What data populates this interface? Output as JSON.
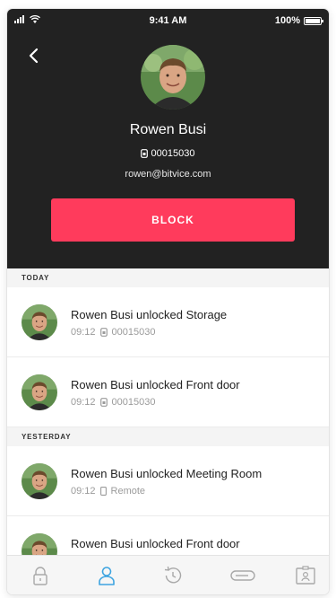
{
  "status_bar": {
    "time": "9:41 AM",
    "battery": "100%",
    "battery_level": 1.0
  },
  "profile": {
    "name": "Rowen Busi",
    "card_number": "00015030",
    "email": "rowen@bitvice.com",
    "block_label": "BLOCK"
  },
  "colors": {
    "header_bg": "#222222",
    "accent": "#ff3b5c",
    "tab_active": "#3ea4e0"
  },
  "sections": {
    "today": "TODAY",
    "yesterday": "YESTERDAY"
  },
  "events": [
    {
      "title": "Rowen Busi unlocked Storage",
      "time": "09:12",
      "method_icon": "keycard-icon",
      "method": "00015030"
    },
    {
      "title": "Rowen Busi unlocked Front door",
      "time": "09:12",
      "method_icon": "keycard-icon",
      "method": "00015030"
    },
    {
      "title": "Rowen Busi unlocked Meeting Room",
      "time": "09:12",
      "method_icon": "phone-icon",
      "method": "Remote"
    },
    {
      "title": "Rowen Busi unlocked Front door",
      "time": "",
      "method_icon": "",
      "method": ""
    }
  ],
  "tabs": [
    {
      "icon": "lock-icon",
      "active": false
    },
    {
      "icon": "user-icon",
      "active": true
    },
    {
      "icon": "history-icon",
      "active": false
    },
    {
      "icon": "keycard-icon",
      "active": false
    },
    {
      "icon": "badge-icon",
      "active": false
    }
  ]
}
